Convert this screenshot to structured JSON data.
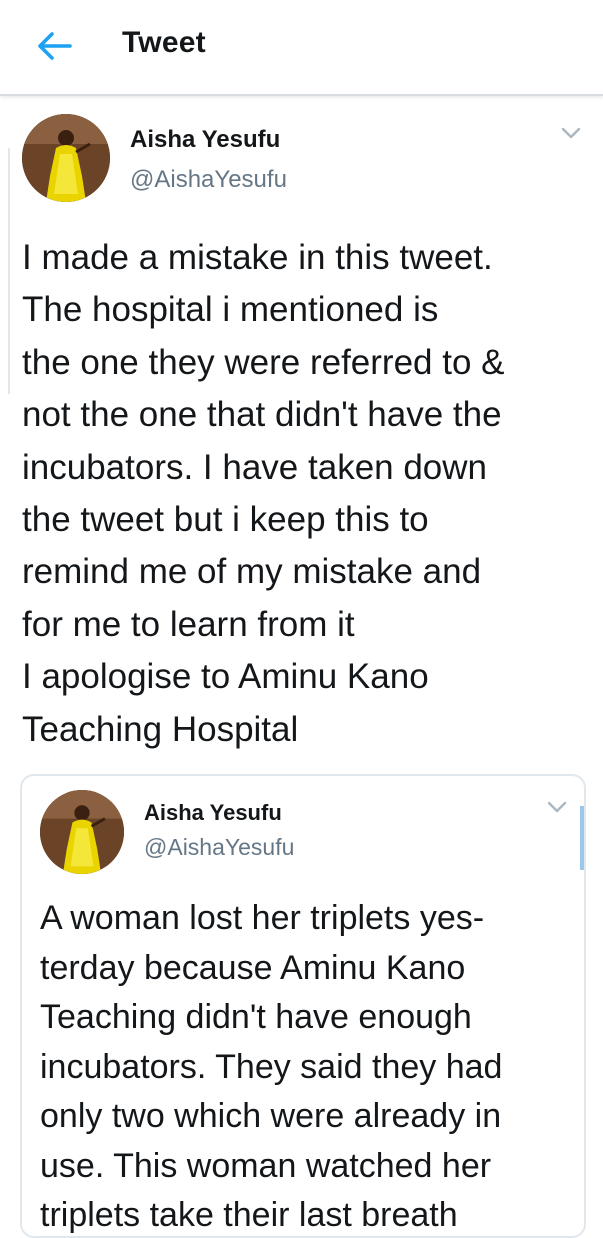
{
  "header": {
    "title": "Tweet"
  },
  "colors": {
    "accent": "#1da1f2",
    "text": "#14171a",
    "secondary_text": "#657786",
    "border": "#e1e8ed"
  },
  "icons": {
    "back": "arrow-left-icon",
    "menu": "chevron-down-icon"
  },
  "tweet": {
    "author_name": "Aisha Yesufu",
    "author_handle": "@AishaYesufu",
    "text": "I made a mistake in this tweet.\nThe hospital i mentioned is\nthe one they were referred to &\nnot the one that didn't have the\nincubators. I have taken down\nthe tweet but i keep this to\nremind me of my mistake and\nfor  me to learn from it\nI apologise to Aminu Kano\nTeaching Hospital"
  },
  "quoted_tweet": {
    "author_name": "Aisha Yesufu",
    "author_handle": "@AishaYesufu",
    "text": "A woman lost her triplets yes-\nterday because Aminu Kano\nTeaching didn't have enough\nincubators. They said they had\nonly two which were already in\nuse. This woman watched her\ntriplets take their last breath"
  }
}
